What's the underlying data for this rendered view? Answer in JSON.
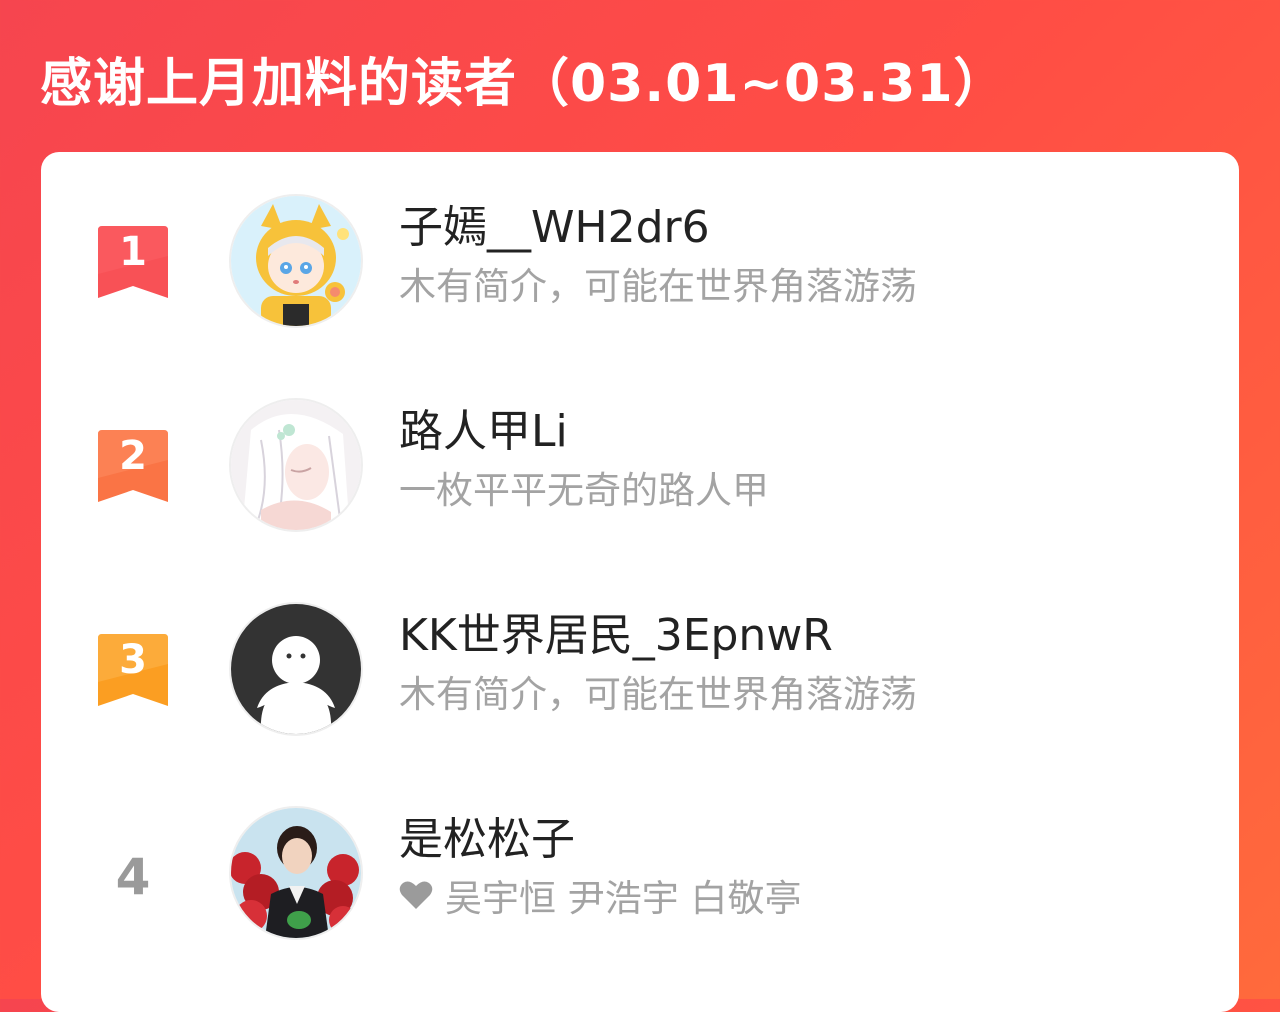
{
  "header": {
    "title": "感谢上月加料的读者（03.01~03.31）"
  },
  "colors": {
    "background_start": "#f6454f",
    "background_end": "#ff6a3c",
    "rank_1": "#f85156",
    "rank_2": "#fa7445",
    "rank_3": "#fb9e22",
    "rank_other": "#9a9a9a"
  },
  "readers": [
    {
      "rank": "1",
      "name": "子嫣__WH2dr6",
      "bio": "木有简介，可能在世界角落游荡",
      "avatar": "cat-hood-girl-avatar"
    },
    {
      "rank": "2",
      "name": "路人甲Li",
      "bio": "一枚平平无奇的路人甲",
      "avatar": "white-hair-anime-avatar"
    },
    {
      "rank": "3",
      "name": "KK世界居民_3EpnwR",
      "bio": "木有简介，可能在世界角落游荡",
      "avatar": "default-ghost-avatar"
    },
    {
      "rank": "4",
      "name": "是松松子",
      "bio": "吴宇恒 尹浩宇 白敬亭",
      "bio_icon": "heart-icon",
      "avatar": "photo-person-avatar"
    }
  ]
}
